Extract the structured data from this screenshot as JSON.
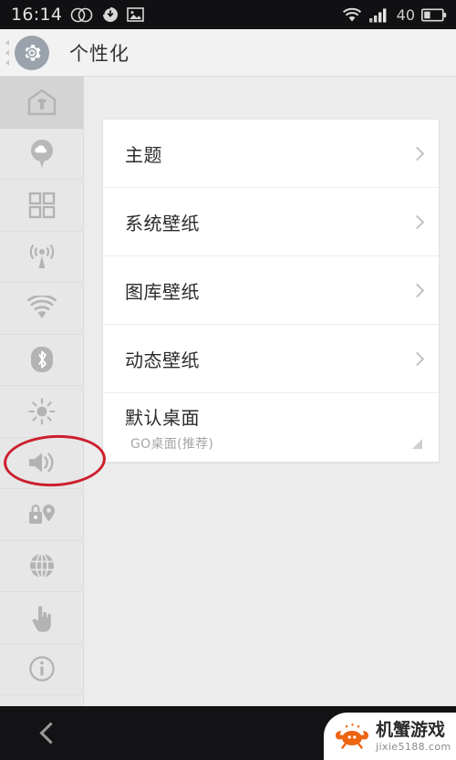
{
  "status_bar": {
    "time": "16:14",
    "left_icons": [
      {
        "name": "dual-sim-icon",
        "glyph": "rings"
      },
      {
        "name": "sync-download-icon",
        "glyph": "sync"
      },
      {
        "name": "screenshot-image-icon",
        "glyph": "image"
      }
    ],
    "right_icons": [
      {
        "name": "wifi-icon"
      },
      {
        "name": "cell-signal-icon"
      }
    ],
    "battery_percent": "40",
    "battery_icon": "battery-icon",
    "background": "#111113"
  },
  "header": {
    "title": "个性化",
    "gear_icon": "gear-icon",
    "handle_icon": "drag-handle-icon",
    "background": "#f2f2f2"
  },
  "sidebar": {
    "items": [
      {
        "name": "sidebar-item-personalization",
        "icon": "home-shirt-icon",
        "active": true
      },
      {
        "name": "sidebar-item-cloud",
        "icon": "cloud-pin-icon",
        "active": false
      },
      {
        "name": "sidebar-item-apps",
        "icon": "grid-apps-icon",
        "active": false
      },
      {
        "name": "sidebar-item-mobile-network",
        "icon": "cell-tower-icon",
        "active": false
      },
      {
        "name": "sidebar-item-wifi",
        "icon": "wifi-icon",
        "active": false
      },
      {
        "name": "sidebar-item-bluetooth",
        "icon": "bluetooth-icon",
        "active": false
      },
      {
        "name": "sidebar-item-display",
        "icon": "brightness-sun-icon",
        "active": false
      },
      {
        "name": "sidebar-item-sound",
        "icon": "speaker-volume-icon",
        "active": false
      },
      {
        "name": "sidebar-item-security-location",
        "icon": "lock-location-icon",
        "active": false
      },
      {
        "name": "sidebar-item-language",
        "icon": "globe-icon",
        "active": false
      },
      {
        "name": "sidebar-item-gestures",
        "icon": "hand-touch-icon",
        "active": false
      },
      {
        "name": "sidebar-item-about",
        "icon": "info-icon",
        "active": false
      }
    ]
  },
  "settings_list": {
    "rows": [
      {
        "title": "主题",
        "sub": "",
        "accessory": "chevron"
      },
      {
        "title": "系统壁纸",
        "sub": "",
        "accessory": "chevron"
      },
      {
        "title": "图库壁纸",
        "sub": "",
        "accessory": "chevron"
      },
      {
        "title": "动态壁纸",
        "sub": "",
        "accessory": "chevron"
      },
      {
        "title": "默认桌面",
        "sub": "GO桌面(推荐)",
        "accessory": "corner"
      }
    ]
  },
  "annotation": {
    "shape": "ellipse",
    "color": "#cc1f2d",
    "targets": "sidebar-item-sound"
  },
  "nav_bar": {
    "back_icon": "back-chevron-icon",
    "background": "#131315"
  },
  "watermark": {
    "name": "机蟹游戏",
    "url": "jixie5188.com",
    "logo_icon": "crab-logo-icon",
    "accent": "#ee6411"
  }
}
